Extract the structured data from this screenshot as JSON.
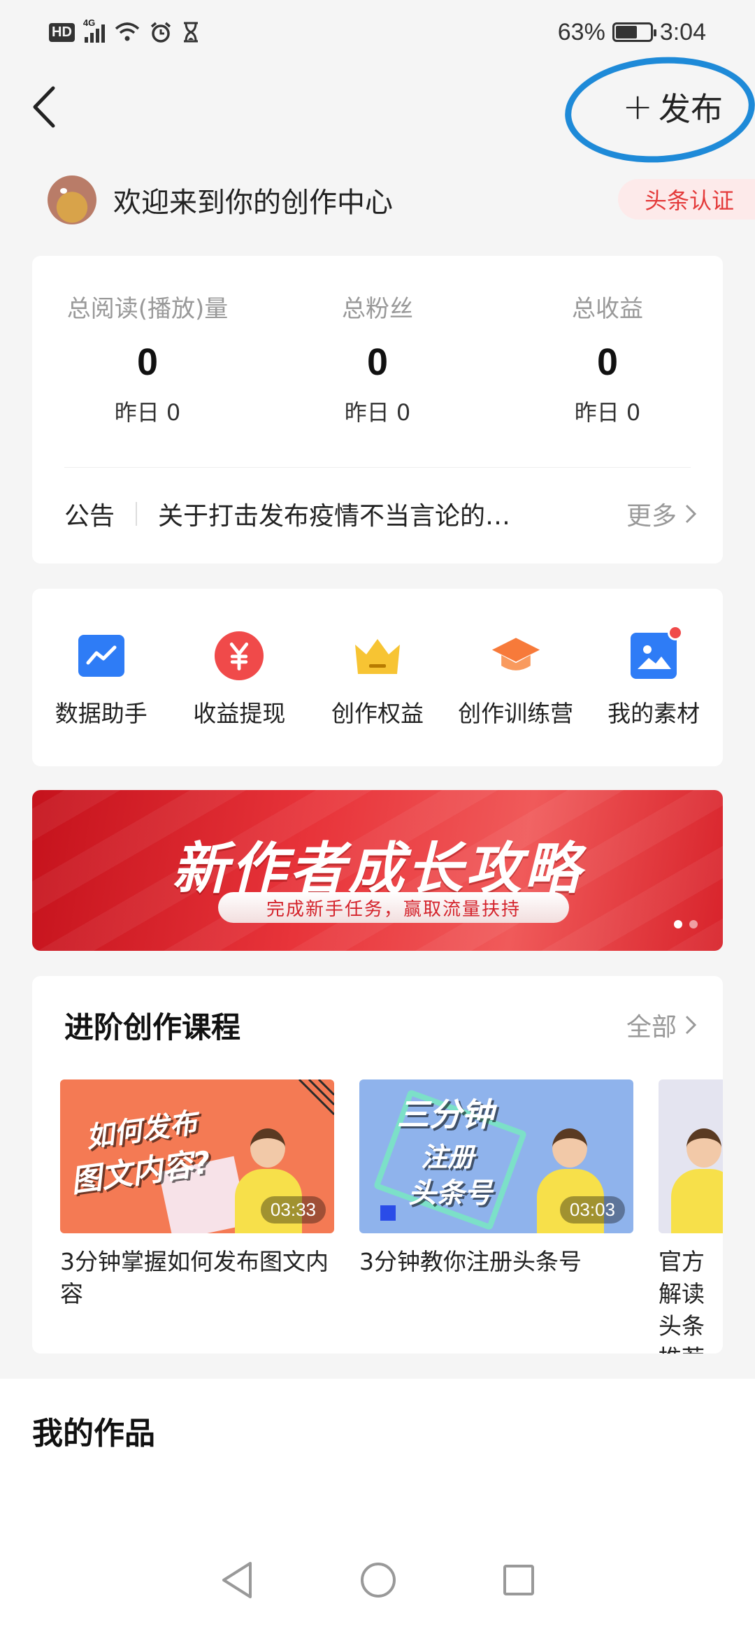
{
  "status_bar": {
    "hd": "HD",
    "network": "4G",
    "battery_percent": "63%",
    "battery_level": 0.63,
    "time": "3:04"
  },
  "header": {
    "publish_label": "发布",
    "annotation_color": "#1e8ad8"
  },
  "welcome": {
    "text": "欢迎来到你的创作中心",
    "badge": "头条认证"
  },
  "stats": [
    {
      "label": "总阅读(播放)量",
      "value": "0",
      "sub": "昨日 0"
    },
    {
      "label": "总粉丝",
      "value": "0",
      "sub": "昨日 0"
    },
    {
      "label": "总收益",
      "value": "0",
      "sub": "昨日 0"
    }
  ],
  "notice": {
    "tag": "公告",
    "message": "关于打击发布疫情不当言论的…",
    "more": "更多"
  },
  "tools": [
    {
      "label": "数据助手",
      "icon": "chart-icon",
      "color": "#2e7cf6"
    },
    {
      "label": "收益提现",
      "icon": "yen-icon",
      "color": "#f04a4a"
    },
    {
      "label": "创作权益",
      "icon": "crown-icon",
      "color": "#f7c433"
    },
    {
      "label": "创作训练营",
      "icon": "graduation-cap-icon",
      "color": "#f77a3a"
    },
    {
      "label": "我的素材",
      "icon": "image-icon",
      "color": "#2e7cf6"
    }
  ],
  "banner": {
    "title": "新作者成长攻略",
    "subtitle": "完成新手任务，赢取流量扶持",
    "slide_count": 2,
    "active_slide": 1
  },
  "courses": {
    "title": "进阶创作课程",
    "all_label": "全部",
    "items": [
      {
        "thumb_text": [
          "如何发布",
          "图文内容?"
        ],
        "duration": "03:33",
        "caption": "3分钟掌握如何发布图文内容",
        "bg": "#f47a54"
      },
      {
        "thumb_text": [
          "三分钟",
          "注册",
          "头条号"
        ],
        "duration": "03:03",
        "caption": "3分钟教你注册头条号",
        "bg": "#8fb3ec"
      },
      {
        "thumb_text": [],
        "duration": "",
        "caption": "官方解读头条推荐",
        "bg": "#e4e4f0"
      }
    ]
  },
  "works": {
    "title": "我的作品"
  },
  "theme": {
    "accent_red": "#e43a3a",
    "muted_text": "#999999"
  }
}
